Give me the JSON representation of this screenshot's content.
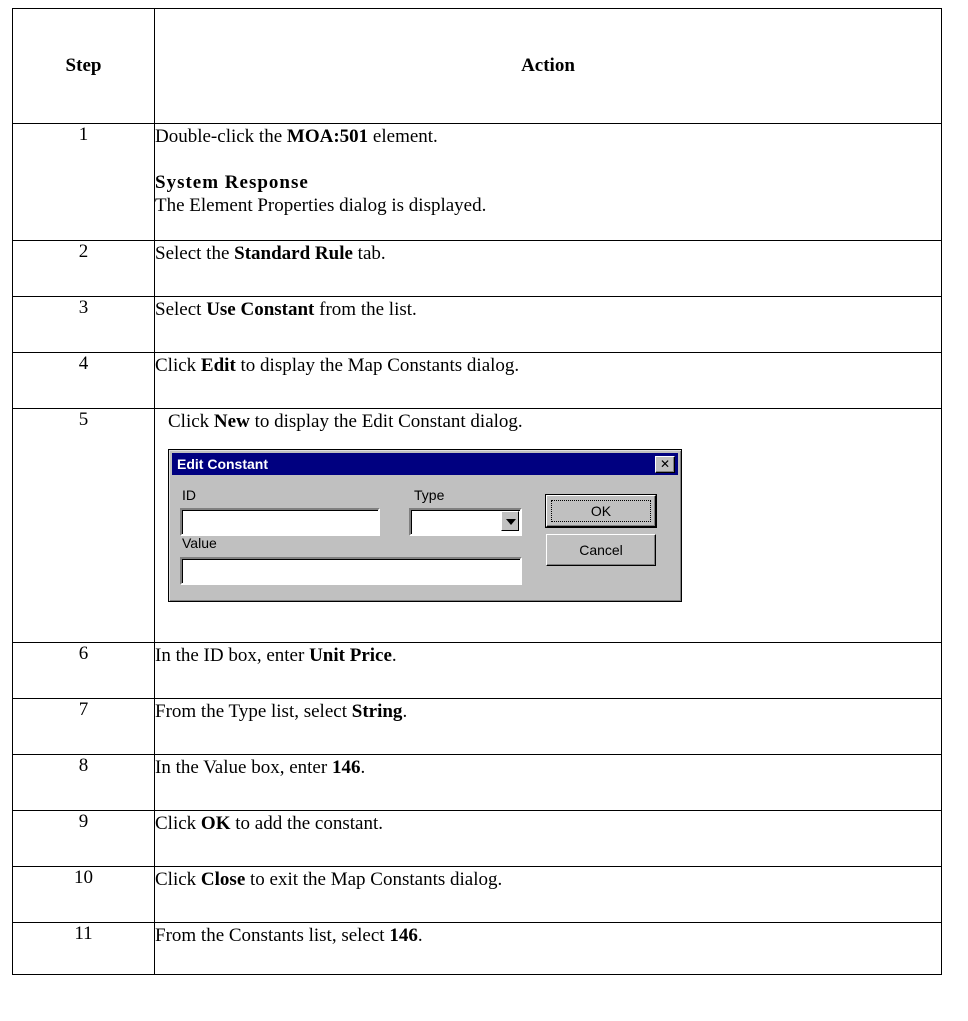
{
  "table": {
    "header": {
      "step": "Step",
      "action": "Action"
    },
    "rows": [
      {
        "step": "1",
        "pre": "Double-click the ",
        "bold": "MOA:501",
        "post": " element.",
        "response_heading": "System Response",
        "response_text": "The Element Properties dialog is displayed."
      },
      {
        "step": "2",
        "pre": "Select the ",
        "bold": "Standard Rule",
        "post": " tab."
      },
      {
        "step": "3",
        "pre": "Select ",
        "bold": "Use Constant",
        "post": " from the list."
      },
      {
        "step": "4",
        "pre": "Click ",
        "bold": "Edit",
        "post": " to display the Map Constants dialog."
      },
      {
        "step": "5",
        "pre": "Click ",
        "bold": "New",
        "post": " to display the Edit Constant dialog."
      },
      {
        "step": "6",
        "pre": "In the ID box, enter ",
        "bold": "Unit Price",
        "post": "."
      },
      {
        "step": "7",
        "pre": "From the Type list, select ",
        "bold": "String",
        "post": "."
      },
      {
        "step": "8",
        "pre": "In the Value box, enter ",
        "bold": "146",
        "post": "."
      },
      {
        "step": "9",
        "pre": "Click ",
        "bold": "OK",
        "post": " to add the constant."
      },
      {
        "step": "10",
        "pre": "Click ",
        "bold": "Close",
        "post": " to exit the Map Constants dialog."
      },
      {
        "step": "11",
        "pre": "From the Constants list, select ",
        "bold": "146",
        "post": "."
      }
    ]
  },
  "dialog": {
    "title": "Edit Constant",
    "close_glyph": "✕",
    "id_label": "ID",
    "id_value": "",
    "type_label": "Type",
    "type_value": "",
    "value_label": "Value",
    "value_value": "",
    "ok_label": "OK",
    "cancel_label": "Cancel"
  },
  "colors": {
    "titlebar": "#000080",
    "dialog_face": "#c0c0c0"
  }
}
